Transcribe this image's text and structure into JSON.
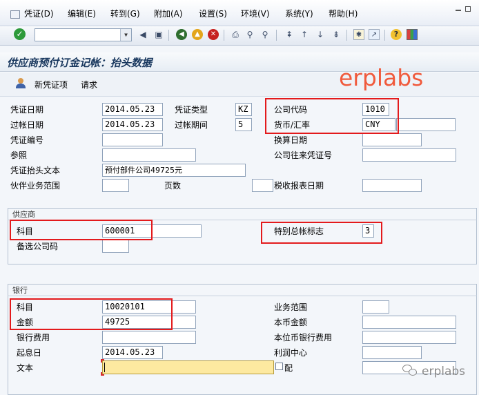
{
  "menu": {
    "items": [
      "凭证(D)",
      "编辑(E)",
      "转到(G)",
      "附加(A)",
      "设置(S)",
      "环境(V)",
      "系统(Y)",
      "帮助(H)"
    ],
    "command_field_value": ""
  },
  "toolbar": {
    "icons": [
      "check-icon",
      "save-icon",
      "back-icon",
      "exit-icon",
      "cancel-icon",
      "print-icon",
      "find-icon",
      "find-next-icon",
      "first-page-icon",
      "prev-page-icon",
      "next-page-icon",
      "last-page-icon",
      "new-session-icon",
      "shortcut-icon",
      "help-icon",
      "layout-icon"
    ]
  },
  "page": {
    "title": "供应商预付订金记帐：抬头数据"
  },
  "apptoolbar": {
    "new_item": "新凭证项",
    "request": "请求"
  },
  "header": {
    "doc_date_label": "凭证日期",
    "doc_date": "2014.05.23",
    "doc_type_label": "凭证类型",
    "doc_type": "KZ",
    "company_code_label": "公司代码",
    "company_code": "1010",
    "posting_date_label": "过帐日期",
    "posting_date": "2014.05.23",
    "period_label": "过帐期间",
    "period": "5",
    "currency_label": "货币/汇率",
    "currency": "CNY",
    "exchange_rate": "",
    "doc_number_label": "凭证编号",
    "doc_number": "",
    "translation_date_label": "换算日期",
    "translation_date": "",
    "reference_label": "参照",
    "reference": "",
    "intercompany_label": "公司往来凭证号",
    "intercompany": "",
    "header_text_label": "凭证抬头文本",
    "header_text": "预付部件公司49725元",
    "trading_partner_label": "伙伴业务范围",
    "trading_partner": "",
    "pages_label": "页数",
    "pages": "",
    "tax_date_label": "税收报表日期",
    "tax_date": ""
  },
  "vendor": {
    "group_title": "供应商",
    "account_label": "科目",
    "account": "600001",
    "special_gl_label": "特别总帐标志",
    "special_gl": "3",
    "alt_company_label": "备选公司码",
    "alt_company": ""
  },
  "bank": {
    "group_title": "银行",
    "account_label": "科目",
    "account": "10020101",
    "business_area_label": "业务范围",
    "business_area": "",
    "amount_label": "金额",
    "amount": "49725",
    "local_amount_label": "本币金额",
    "local_amount": "",
    "bank_charges_label": "银行费用",
    "bank_charges": "",
    "local_bank_charges_label": "本位币银行费用",
    "local_bank_charges": "",
    "value_date_label": "起息日",
    "value_date": "2014.05.23",
    "profit_center_label": "利润中心",
    "profit_center": "",
    "text_label": "文本",
    "text": "",
    "assignment_label": "配",
    "assignment": ""
  },
  "watermarks": {
    "top": "erplabs",
    "bottom": "erplabs"
  },
  "colors": {
    "highlight_box": "#e31a1c",
    "watermark": "#f05a3c",
    "title_text": "#17365d",
    "active_field_bg": "#fde9a0"
  }
}
